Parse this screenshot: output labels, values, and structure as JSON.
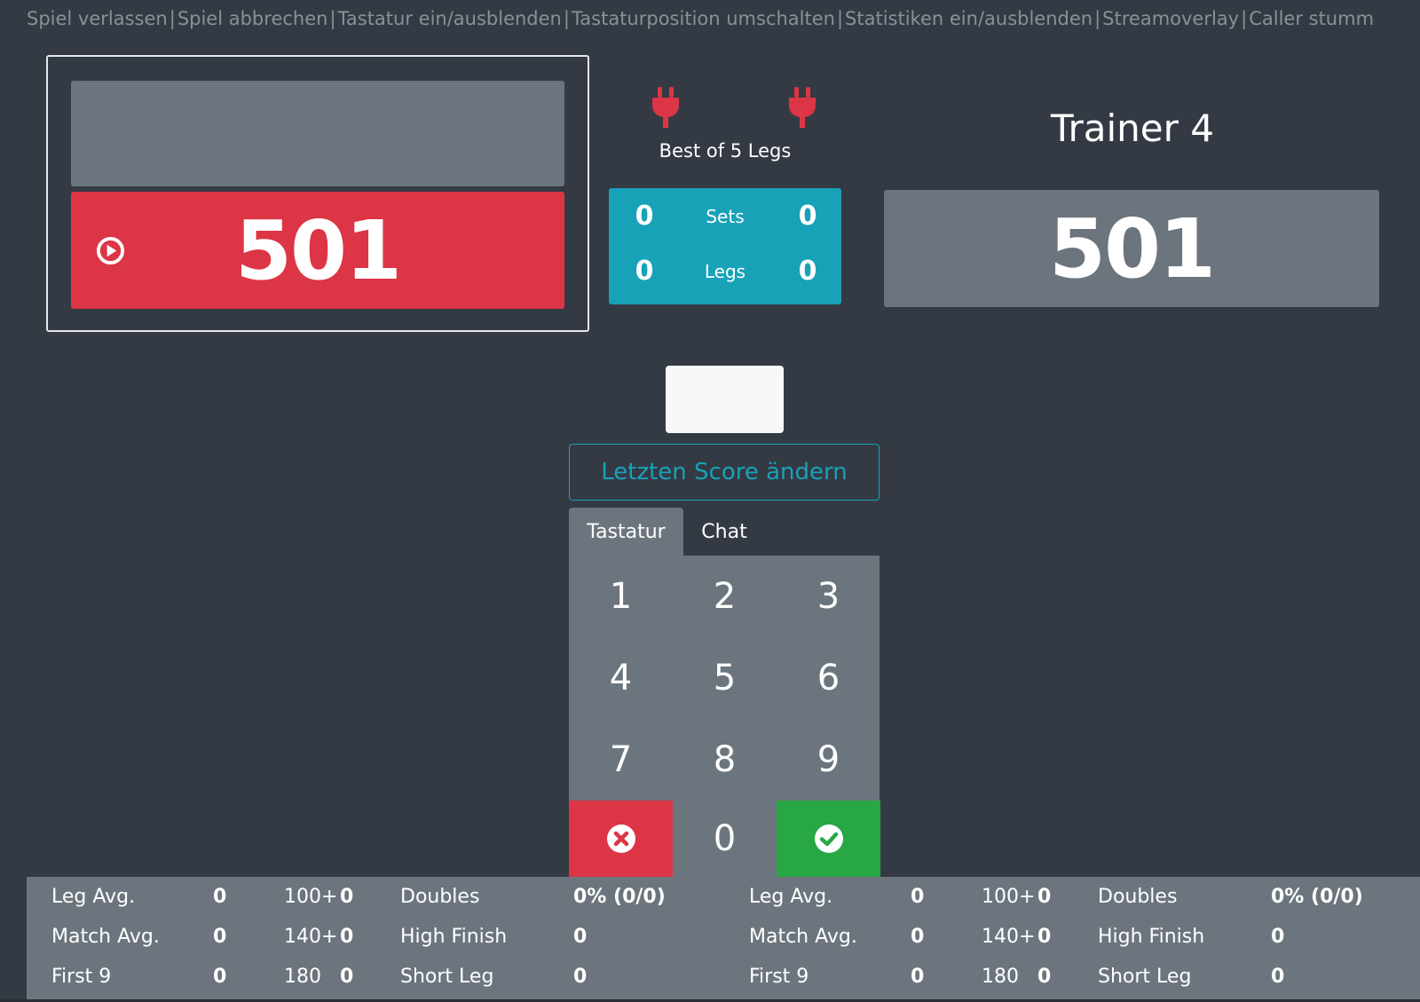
{
  "top_menu": {
    "items": [
      "Spiel verlassen",
      "Spiel abbrechen",
      "Tastatur ein/ausblenden",
      "Tastaturposition umschalten",
      "Statistiken ein/ausblenden",
      "Streamoverlay",
      "Caller stumm"
    ],
    "separator": "|"
  },
  "player1": {
    "name": "",
    "score": "501",
    "turn_icon": "play-circle-icon",
    "accent": "#dc3545"
  },
  "player2": {
    "name": "Trainer 4",
    "score": "501"
  },
  "match": {
    "format": "Best of 5 Legs",
    "sets_label": "Sets",
    "legs_label": "Legs",
    "p1_sets": "0",
    "p2_sets": "0",
    "p1_legs": "0",
    "p2_legs": "0",
    "connection_icons": [
      "plug-icon",
      "plug-icon"
    ],
    "accent": "#17a2b8"
  },
  "input": {
    "value": ""
  },
  "edit_last_label": "Letzten Score ändern",
  "tabs": {
    "keyboard": "Tastatur",
    "chat": "Chat"
  },
  "keypad": {
    "keys": [
      "1",
      "2",
      "3",
      "4",
      "5",
      "6",
      "7",
      "8",
      "9"
    ],
    "zero": "0",
    "cancel_icon": "close-circle-icon",
    "confirm_icon": "check-circle-icon"
  },
  "stats": {
    "labels": {
      "leg_avg": "Leg Avg.",
      "match_avg": "Match Avg.",
      "first9": "First 9",
      "t100": "100+",
      "t140": "140+",
      "t180": "180",
      "doubles": "Doubles",
      "high_finish": "High Finish",
      "short_leg": "Short Leg"
    },
    "player1": {
      "leg_avg": "0",
      "match_avg": "0",
      "first9": "0",
      "t100": "0",
      "t140": "0",
      "t180": "0",
      "doubles": "0% (0/0)",
      "high_finish": "0",
      "short_leg": "0"
    },
    "player2": {
      "leg_avg": "0",
      "match_avg": "0",
      "first9": "0",
      "t100": "0",
      "t140": "0",
      "t180": "0",
      "doubles": "0% (0/0)",
      "high_finish": "0",
      "short_leg": "0"
    }
  }
}
